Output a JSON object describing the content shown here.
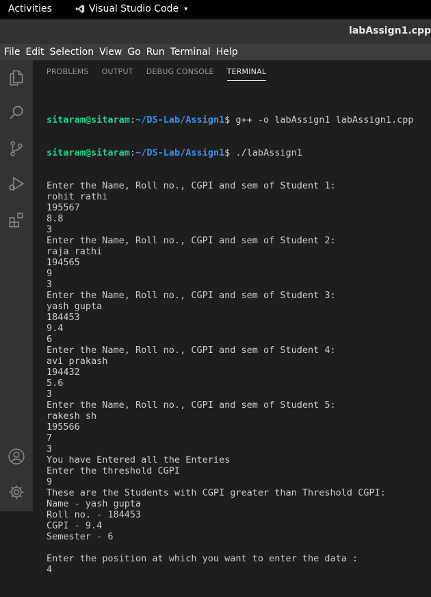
{
  "topbar": {
    "activities": "Activities",
    "app_name": "Visual Studio Code",
    "app_caret": "▾"
  },
  "window": {
    "title": "labAssign1.cpp"
  },
  "menu": {
    "items": [
      "File",
      "Edit",
      "Selection",
      "View",
      "Go",
      "Run",
      "Terminal",
      "Help"
    ]
  },
  "activity_bar": {
    "icons": [
      "files-icon",
      "search-icon",
      "source-control-icon",
      "run-debug-icon",
      "extensions-icon",
      "account-icon",
      "settings-gear-icon"
    ]
  },
  "panel": {
    "tabs": [
      "PROBLEMS",
      "OUTPUT",
      "DEBUG CONSOLE",
      "TERMINAL"
    ],
    "active_tab": "TERMINAL"
  },
  "terminal": {
    "prompt_user": "sitaram@sitaram",
    "prompt_colon": ":",
    "prompt_path": "~/DS-Lab/Assign1",
    "prompt_dollar": "$ ",
    "commands": [
      "g++ -o labAssign1 labAssign1.cpp",
      "./labAssign1"
    ],
    "output_lines": [
      "Enter the Name, Roll no., CGPI and sem of Student 1:",
      "rohit rathi",
      "195567",
      "8.8",
      "3",
      "Enter the Name, Roll no., CGPI and sem of Student 2:",
      "raja rathi",
      "194565",
      "9",
      "3",
      "Enter the Name, Roll no., CGPI and sem of Student 3:",
      "yash gupta",
      "184453",
      "9.4",
      "6",
      "Enter the Name, Roll no., CGPI and sem of Student 4:",
      "avi prakash",
      "194432",
      "5.6",
      "3",
      "Enter the Name, Roll no., CGPI and sem of Student 5:",
      "rakesh sh",
      "195566",
      "7",
      "3",
      "You have Entered all the Enteries",
      "Enter the threshold CGPI",
      "9",
      "These are the Students with CGPI greater than Threshold CGPI:",
      "Name - yash gupta",
      "Roll no. - 184453",
      "CGPI - 9.4",
      "Semester - 6",
      "",
      "Enter the position at which you want to enter the data :",
      "4"
    ]
  },
  "colors": {
    "prompt_user": "#23d18b",
    "prompt_path": "#3b8eea",
    "text": "#cccccc",
    "background": "#1e1e1e"
  }
}
